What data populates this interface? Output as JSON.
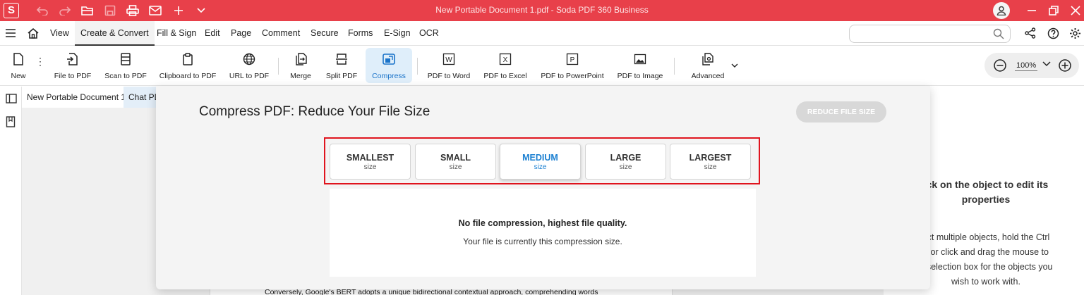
{
  "titlebar": {
    "logo": "S",
    "title": "New Portable Document 1.pdf  -  Soda PDF 360 Business",
    "color": "#e8404a"
  },
  "menubar": {
    "items": [
      "View",
      "Create & Convert",
      "Fill & Sign",
      "Edit",
      "Page",
      "Comment",
      "Secure",
      "Forms",
      "E-Sign",
      "OCR"
    ],
    "active": "Create & Convert",
    "search_value": ""
  },
  "ribbon": {
    "items": [
      {
        "label": "New",
        "icon": "new-file-icon"
      },
      {
        "label": "File to PDF",
        "icon": "file-to-pdf-icon"
      },
      {
        "label": "Scan to PDF",
        "icon": "scanner-icon"
      },
      {
        "label": "Clipboard to PDF",
        "icon": "clipboard-icon"
      },
      {
        "label": "URL to PDF",
        "icon": "globe-icon"
      },
      {
        "label": "Merge",
        "icon": "merge-icon"
      },
      {
        "label": "Split PDF",
        "icon": "split-icon"
      },
      {
        "label": "Compress",
        "icon": "compress-icon",
        "active": true
      },
      {
        "label": "PDF to Word",
        "icon": "word-icon",
        "glyph": "W"
      },
      {
        "label": "PDF to Excel",
        "icon": "excel-icon",
        "glyph": "X"
      },
      {
        "label": "PDF to PowerPoint",
        "icon": "powerpoint-icon",
        "glyph": "P"
      },
      {
        "label": "PDF to Image",
        "icon": "image-icon"
      },
      {
        "label": "Advanced",
        "icon": "advanced-icon"
      }
    ],
    "accent": "#1a73c9"
  },
  "zoom": {
    "value": "100%"
  },
  "doc_tabs": [
    "New Portable Document 1",
    "Chat PD"
  ],
  "document": {
    "visible_text": "Conversely, Google's BERT adopts a unique bidirectional contextual approach, comprehending words"
  },
  "right_panel": {
    "title_line1": "ick on the object to edit its",
    "title_line2": "properties",
    "body_lines": [
      "ect multiple objects, hold the Ctrl",
      "n or click and drag the mouse to",
      "a selection box for the objects you",
      "wish to work with."
    ]
  },
  "compress": {
    "title": "Compress PDF: Reduce Your File Size",
    "reduce_button": "REDUCE FILE SIZE",
    "options": [
      {
        "name": "SMALLEST",
        "sub": "size"
      },
      {
        "name": "SMALL",
        "sub": "size"
      },
      {
        "name": "MEDIUM",
        "sub": "size"
      },
      {
        "name": "LARGE",
        "sub": "size"
      },
      {
        "name": "LARGEST",
        "sub": "size"
      }
    ],
    "selected": "MEDIUM",
    "info_main": "No file compression, highest file quality.",
    "info_sub": "Your file is currently this compression size.",
    "highlight_color": "#e0141e",
    "selected_color": "#1a7fd1"
  }
}
